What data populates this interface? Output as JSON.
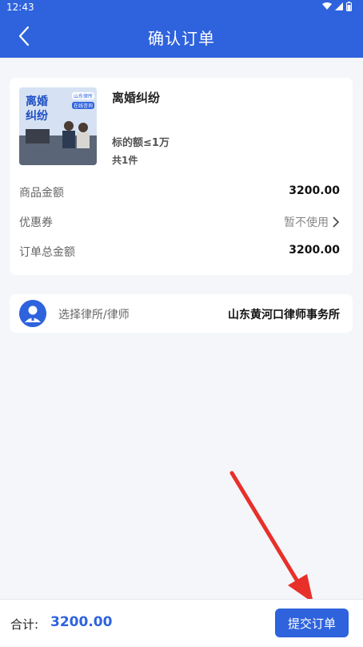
{
  "status": {
    "time": "12:43"
  },
  "nav": {
    "title": "确认订单"
  },
  "product": {
    "image_text_main": "离婚纠纷",
    "image_badges": [
      "山东律所",
      "在线咨询"
    ],
    "name": "离婚纠纷",
    "spec": "标的额≤1万",
    "quantity": "共1件"
  },
  "summary": {
    "goods_amount_label": "商品金额",
    "goods_amount_value": "3200.00",
    "coupon_label": "优惠券",
    "coupon_value": "暂不使用",
    "total_label": "订单总金额",
    "total_value": "3200.00"
  },
  "lawyer": {
    "label": "选择律所/律师",
    "value": "山东黄河口律师事务所"
  },
  "footer": {
    "total_label": "合计:",
    "total_value": "3200.00",
    "submit_label": "提交订单"
  },
  "colors": {
    "primary": "#2f63dd",
    "annotation_arrow": "#e8302a"
  }
}
